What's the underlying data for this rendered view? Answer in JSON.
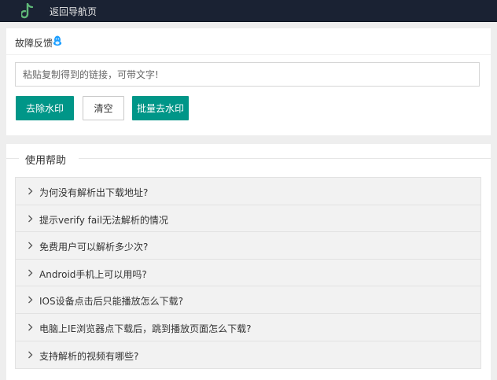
{
  "topbar": {
    "back_label": "返回导航页",
    "logo_icon": "music-note-logo-icon"
  },
  "feedback": {
    "title": "故障反馈",
    "icon": "qq-penguin-icon"
  },
  "input": {
    "placeholder": "粘贴复制得到的链接，可带文字!",
    "value": ""
  },
  "buttons": {
    "remove_watermark": "去除水印",
    "clear": "清空",
    "batch_remove": "批量去水印"
  },
  "help": {
    "title": "使用帮助",
    "items": [
      "为何没有解析出下载地址?",
      "提示verify fail无法解析的情况",
      "免费用户可以解析多少次?",
      "Android手机上可以用吗?",
      "IOS设备点击后只能播放怎么下载?",
      "电脑上IE浏览器点下载后，跳到播放页面怎么下载?",
      "支持解析的视频有哪些?"
    ]
  },
  "colors": {
    "topbar": "#1a2233",
    "accent": "#009688",
    "logo_green": "#5fb878",
    "qq_blue": "#1e9fff"
  }
}
